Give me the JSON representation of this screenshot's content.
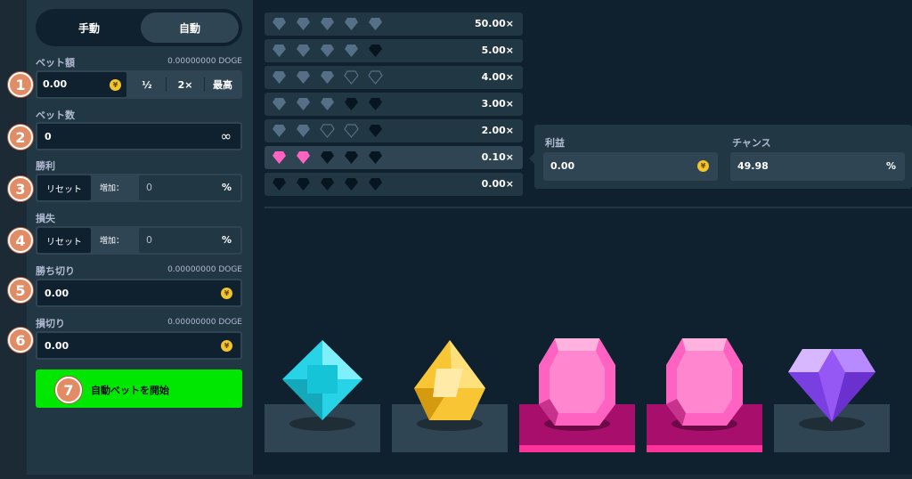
{
  "mode_tabs": {
    "manual": "手動",
    "auto": "自動"
  },
  "bet_amount": {
    "label": "ベット額",
    "converted": "0.00000000 DOGE",
    "value": "0.00",
    "coin_icon": "¥",
    "half": "½",
    "double": "2×",
    "max": "最高"
  },
  "bet_count": {
    "label": "ベット数",
    "value": "0",
    "infinity_icon": "∞"
  },
  "on_win": {
    "label": "勝利",
    "reset": "リセット",
    "increase": "増加：",
    "value": "0",
    "pct": "%"
  },
  "on_loss": {
    "label": "損失",
    "reset": "リセット",
    "increase": "増加：",
    "value": "0",
    "pct": "%"
  },
  "stop_profit": {
    "label": "勝ち切り",
    "converted": "0.00000000 DOGE",
    "value": "0.00",
    "coin_icon": "¥"
  },
  "stop_loss": {
    "label": "損切り",
    "converted": "0.00000000 DOGE",
    "value": "0.00",
    "coin_icon": "¥"
  },
  "start_button": "自動ベットを開始",
  "badges": [
    "1",
    "2",
    "3",
    "4",
    "5",
    "6",
    "7"
  ],
  "payout_rows": [
    {
      "multiplier": "50.00×",
      "pattern": [
        "g",
        "g",
        "g",
        "g",
        "g"
      ]
    },
    {
      "multiplier": "5.00×",
      "pattern": [
        "g",
        "g",
        "g",
        "g",
        "d"
      ]
    },
    {
      "multiplier": "4.00×",
      "pattern": [
        "g",
        "g",
        "g",
        "o",
        "o"
      ]
    },
    {
      "multiplier": "3.00×",
      "pattern": [
        "g",
        "g",
        "g",
        "d",
        "d"
      ]
    },
    {
      "multiplier": "2.00×",
      "pattern": [
        "g",
        "g",
        "o",
        "o",
        "d"
      ]
    },
    {
      "multiplier": "0.10×",
      "pattern": [
        "p",
        "p",
        "d",
        "d",
        "d"
      ],
      "active": true
    },
    {
      "multiplier": "0.00×",
      "pattern": [
        "d",
        "d",
        "d",
        "d",
        "d"
      ]
    }
  ],
  "profit": {
    "label": "利益",
    "value": "0.00",
    "coin_icon": "¥"
  },
  "chance": {
    "label": "チャンス",
    "value": "49.98",
    "pct": "%"
  },
  "gems": [
    {
      "name": "cyan-diamond-gem",
      "color": "#28d3e7",
      "win": false
    },
    {
      "name": "yellow-gem",
      "color": "#f8c534",
      "win": false
    },
    {
      "name": "pink-gem",
      "color": "#ff63c1",
      "win": true
    },
    {
      "name": "pink-gem",
      "color": "#ff63c1",
      "win": true
    },
    {
      "name": "purple-gem",
      "color": "#9658f5",
      "win": false
    }
  ],
  "colors": {
    "accent_green": "#00e701",
    "win_slot": "#a80f6d",
    "badge": "#e28c66"
  }
}
